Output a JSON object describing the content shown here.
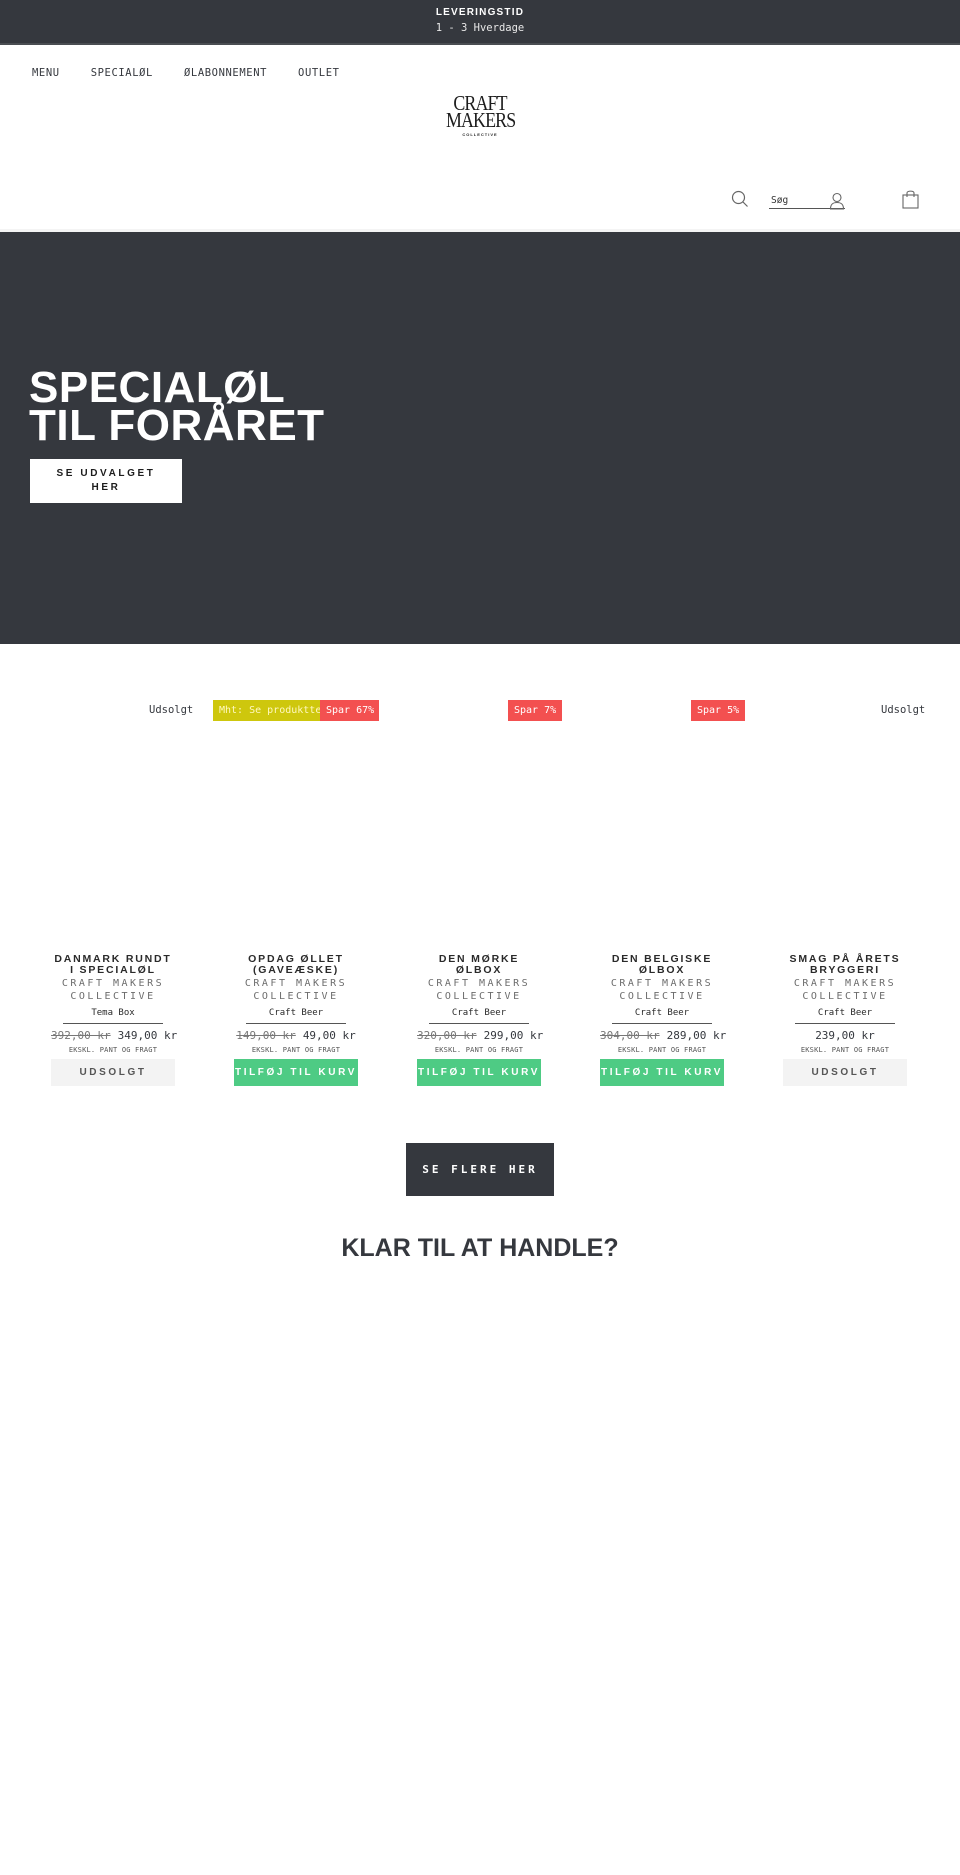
{
  "announcement": {
    "title": "LEVERINGSTID",
    "subtitle": "1 - 3 Hverdage"
  },
  "nav": {
    "items": [
      {
        "label": "MENU"
      },
      {
        "label": "SPECIALØL"
      },
      {
        "label": "ØLABONNEMENT"
      },
      {
        "label": "OUTLET"
      }
    ]
  },
  "logo": {
    "line1": "CRAFT",
    "line2": "MAKERS",
    "line3": "COLLECTIVE"
  },
  "header": {
    "search_placeholder": "Søg",
    "icons": [
      "search-icon",
      "user-icon",
      "cart-icon"
    ]
  },
  "hero": {
    "title_line1": "SPECIALØL",
    "title_line2": "TIL FORÅRET",
    "cta_label": "SE UDVALGET HER",
    "background": "#35383e"
  },
  "badges": {
    "sold_out_1": "Udsolgt",
    "notice": "Mht: Se produkttekst",
    "save_67": "Spar 67%",
    "save_7": "Spar 7%",
    "save_5": "Spar 5%",
    "sold_out_2": "Udsolgt"
  },
  "products": [
    {
      "title": "DANMARK RUNDT I SPECIALØL",
      "vendor": "CRAFT MAKERS COLLECTIVE",
      "type": "Tema Box",
      "old_price": "392,00 kr",
      "price": "349,00 kr",
      "note": "EKSKL. PANT OG FRAGT",
      "button": "UDSOLGT",
      "available": false
    },
    {
      "title": "OPDAG ØLLET (GAVEÆSKE)",
      "vendor": "CRAFT MAKERS COLLECTIVE",
      "type": "Craft Beer",
      "old_price": "149,00 kr",
      "price": "49,00 kr",
      "note": "EKSKL. PANT OG FRAGT",
      "button": "TILFØJ TIL KURV",
      "available": true
    },
    {
      "title": "DEN MØRKE ØLBOX",
      "vendor": "CRAFT MAKERS COLLECTIVE",
      "type": "Craft Beer",
      "old_price": "320,00 kr",
      "price": "299,00 kr",
      "note": "EKSKL. PANT OG FRAGT",
      "button": "TILFØJ TIL KURV",
      "available": true
    },
    {
      "title": "DEN BELGISKE ØLBOX",
      "vendor": "CRAFT MAKERS COLLECTIVE",
      "type": "Craft Beer",
      "old_price": "304,00 kr",
      "price": "289,00 kr",
      "note": "EKSKL. PANT OG FRAGT",
      "button": "TILFØJ TIL KURV",
      "available": true
    },
    {
      "title": "SMAG PÅ ÅRETS BRYGGERI",
      "vendor": "CRAFT MAKERS COLLECTIVE",
      "type": "Craft Beer",
      "old_price": "",
      "price": "239,00 kr",
      "note": "EKSKL. PANT OG FRAGT",
      "button": "UDSOLGT",
      "available": false
    }
  ],
  "more_button": "SE FLERE HER",
  "ready_heading": "KLAR TIL AT HANDLE?",
  "colors": {
    "dark": "#35383e",
    "sale_red": "#f35050",
    "notice_yellow": "#cec70d",
    "add_green": "#4ecb84",
    "sold_grey": "#f3f3f3"
  }
}
